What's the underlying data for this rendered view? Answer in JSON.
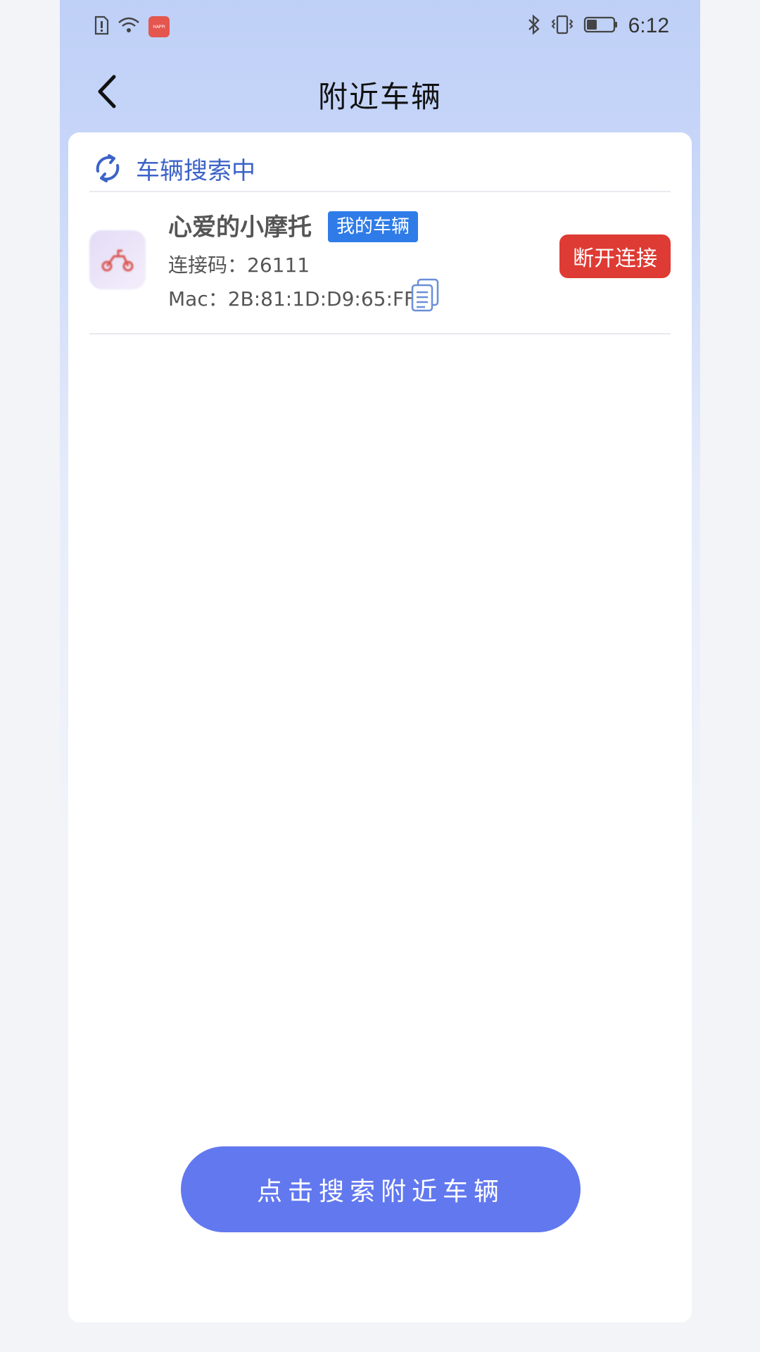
{
  "status_bar": {
    "time": "6:12",
    "app_badge_text": "HAPPI",
    "icons": [
      "sim-alert-icon",
      "wifi-icon",
      "app-badge-icon",
      "bluetooth-icon",
      "vibrate-icon",
      "battery-icon"
    ]
  },
  "header": {
    "title": "附近车辆",
    "back_icon": "chevron-left-icon"
  },
  "search_status": {
    "label": "车辆搜索中",
    "icon": "refresh-icon",
    "color": "#3d63c8"
  },
  "vehicles": [
    {
      "name": "心爱的小摩托",
      "tag": "我的车辆",
      "connection_code": "连接码：26111",
      "mac": "Mac：2B:81:1D:D9:65:FF",
      "action_label": "断开连接"
    }
  ],
  "search_button": {
    "label": "点击搜索附近车辆"
  },
  "colors": {
    "accent": "#6278ef",
    "tag": "#2f7ce8",
    "danger": "#de3b34",
    "header_bg": "#bfd0f7"
  }
}
